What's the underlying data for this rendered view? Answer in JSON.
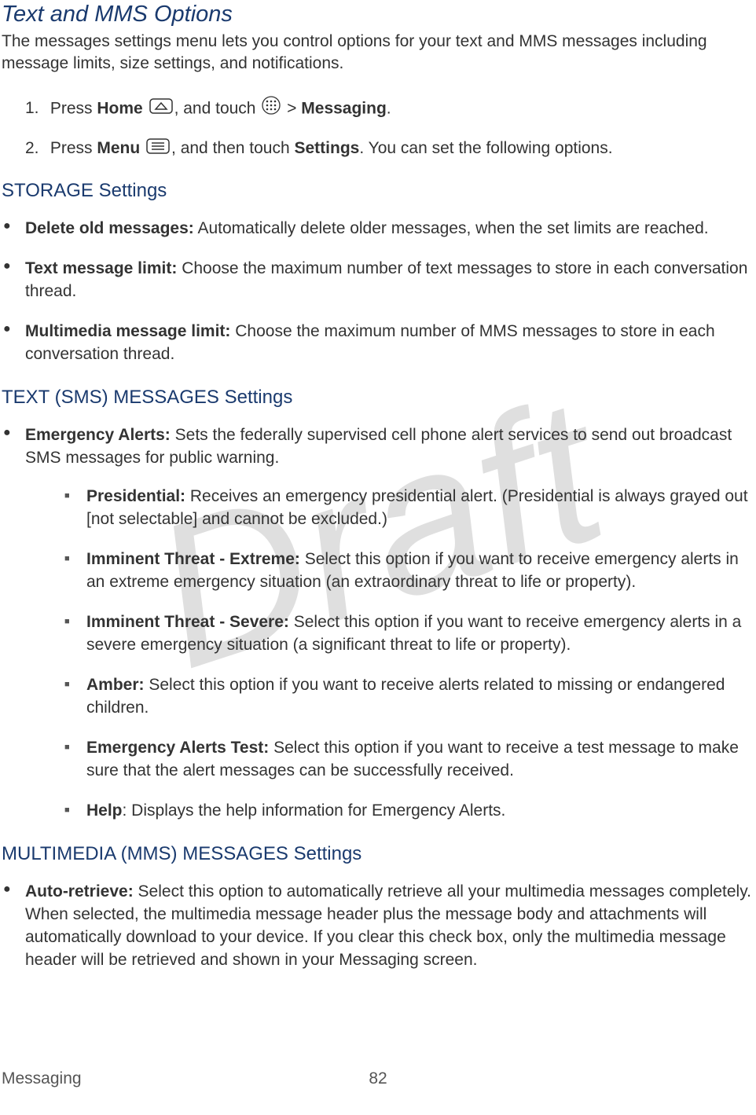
{
  "watermark": "Draft",
  "title": "Text and MMS Options",
  "intro": "The messages settings menu lets you control options for your text and MMS messages including message limits, size settings, and notifications.",
  "steps": {
    "s1": {
      "num": "1.",
      "t1": "Press ",
      "home": "Home",
      "t2": ", and touch ",
      "t3": " > ",
      "messaging": "Messaging",
      "t4": "."
    },
    "s2": {
      "num": "2.",
      "t1": "Press ",
      "menu": "Menu",
      "t2": ", and then touch ",
      "settings": "Settings",
      "t3": ". You can set the following options."
    }
  },
  "storage": {
    "head": "STORAGE Settings",
    "b1": {
      "label": "Delete old messages:",
      "desc": " Automatically delete older messages, when the set limits are reached."
    },
    "b2": {
      "label": "Text message limit:",
      "desc": " Choose the maximum number of text messages to store in each conversation thread."
    },
    "b3": {
      "label": "Multimedia message limit:",
      "desc": " Choose the maximum number of MMS messages to store in each conversation thread."
    }
  },
  "sms": {
    "head": "TEXT (SMS) MESSAGES Settings",
    "b1": {
      "label": "Emergency Alerts:",
      "desc": " Sets the federally supervised cell phone alert services to send out broadcast SMS messages for public warning."
    },
    "sub": {
      "a": {
        "label": "Presidential:",
        "desc": " Receives an emergency presidential alert. (Presidential is always grayed out [not selectable] and cannot be excluded.)"
      },
      "b": {
        "label": "Imminent Threat - Extreme:",
        "desc": " Select this option if you want to receive emergency alerts in an extreme emergency situation (an extraordinary threat to life or property)."
      },
      "c": {
        "label": "Imminent Threat - Severe:",
        "desc": " Select this option if you want to receive emergency alerts in a severe emergency situation (a significant threat to life or property)."
      },
      "d": {
        "label": "Amber:",
        "desc": " Select this option if you want to receive alerts related to missing or endangered children."
      },
      "e": {
        "label": "Emergency Alerts Test:",
        "desc": " Select this option if you want to receive a test message to make sure that the alert messages can be successfully received."
      },
      "f": {
        "label": "Help",
        "desc": ": Displays the help information for Emergency Alerts."
      }
    }
  },
  "mms": {
    "head": "MULTIMEDIA (MMS) MESSAGES Settings",
    "b1": {
      "label": "Auto-retrieve:",
      "desc": " Select this option to automatically retrieve all your multimedia messages completely. When selected, the multimedia message header plus the message body and attachments will automatically download to your device. If you clear this check box, only the multimedia message header will be retrieved and shown in your Messaging screen."
    }
  },
  "footer": {
    "section": "Messaging",
    "page": "82"
  }
}
